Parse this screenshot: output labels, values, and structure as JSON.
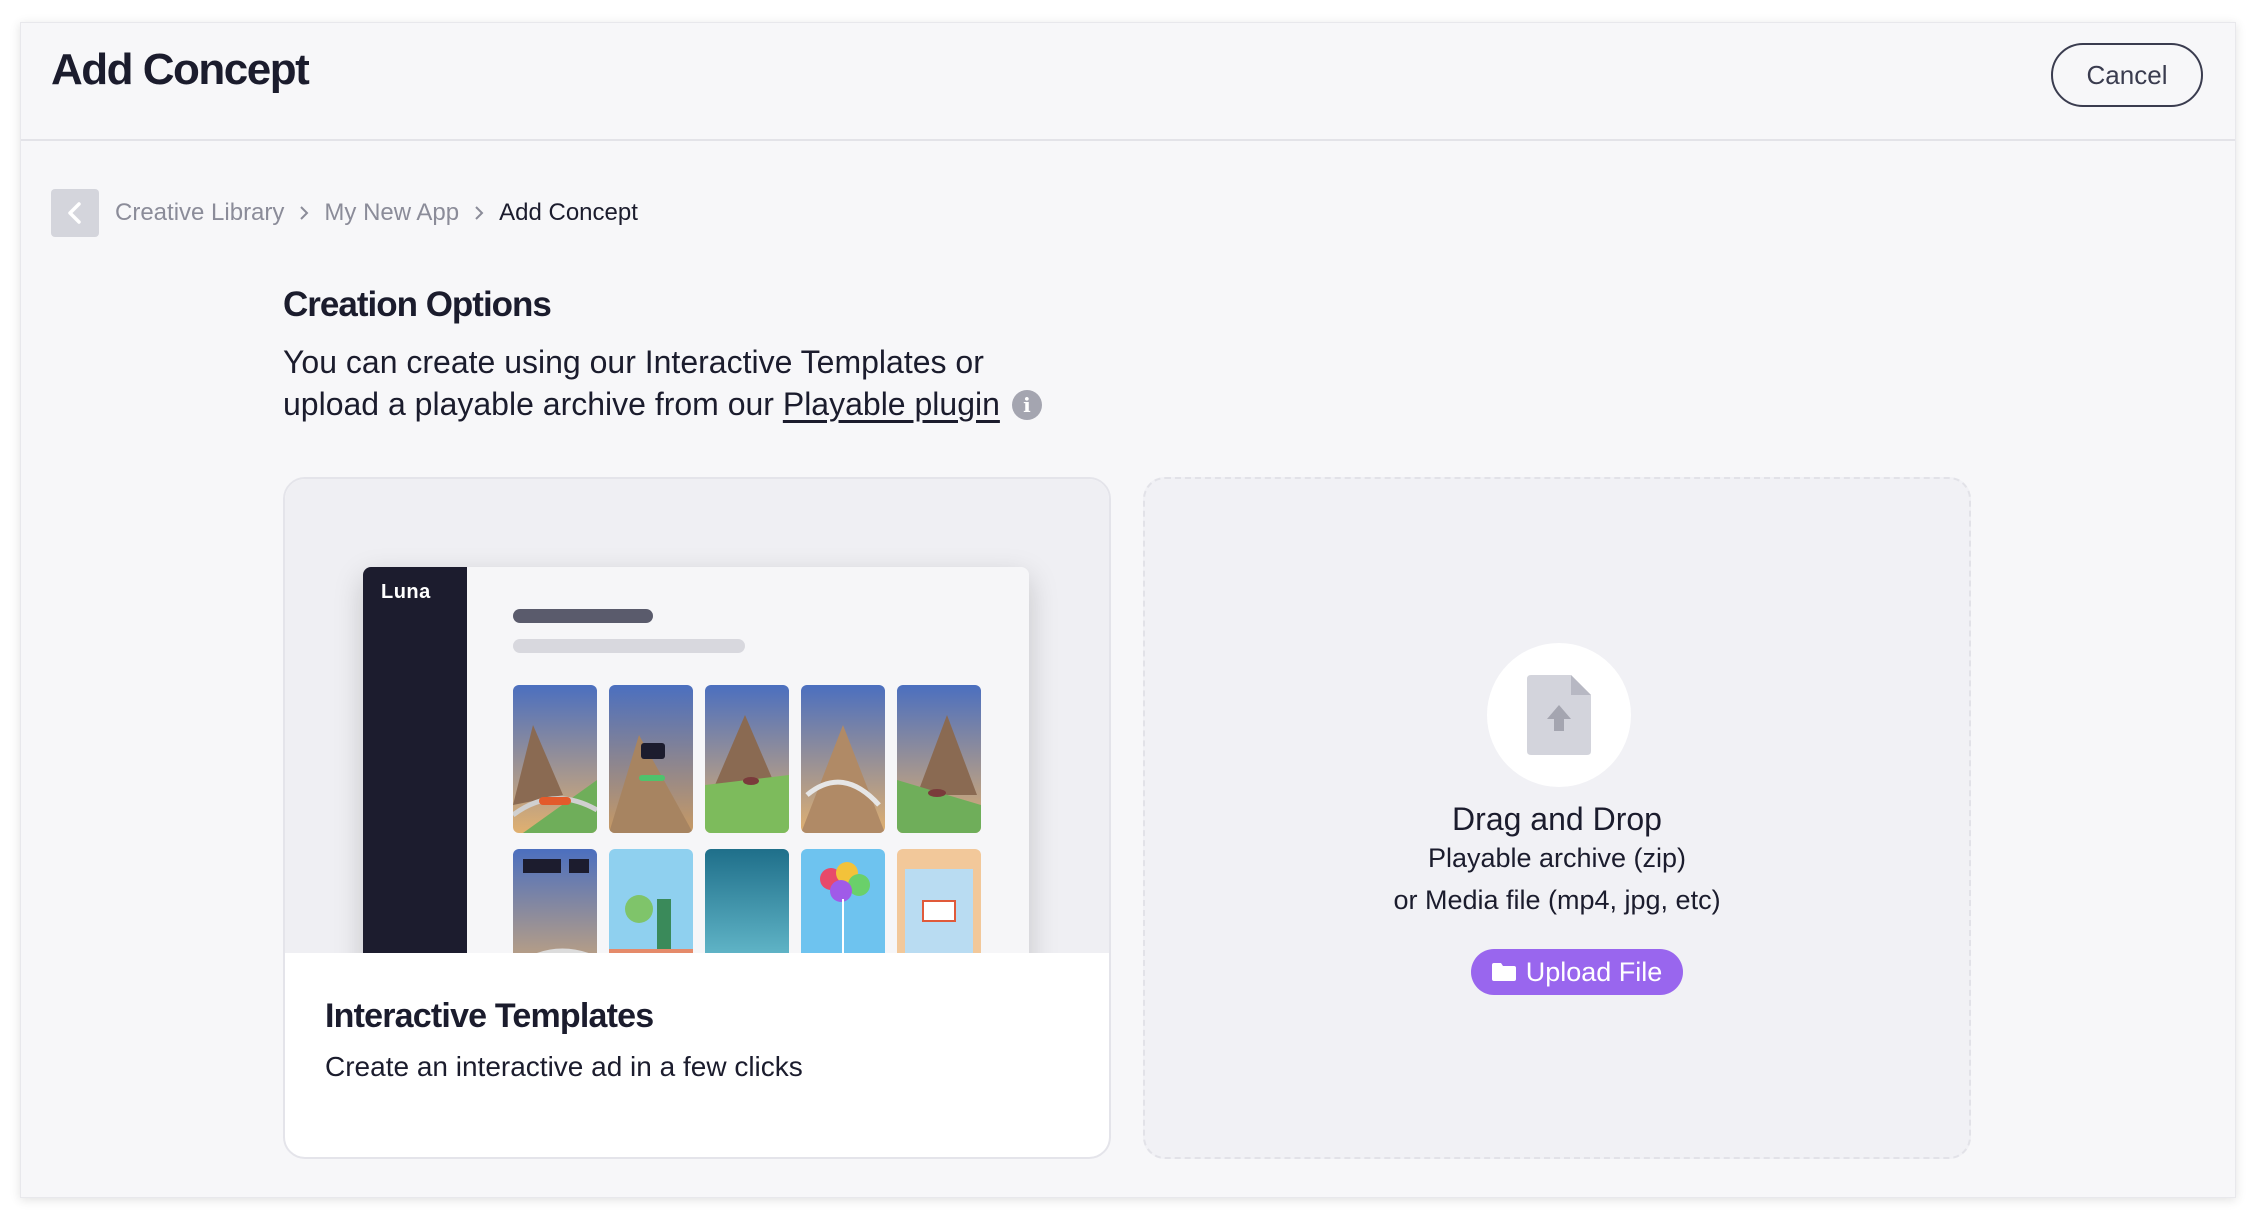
{
  "header": {
    "title": "Add Concept",
    "cancel_label": "Cancel"
  },
  "breadcrumb": {
    "items": [
      "Creative Library",
      "My New App",
      "Add Concept"
    ]
  },
  "creation": {
    "title": "Creation Options",
    "desc_line1": "You can create using our Interactive Templates or",
    "desc_line2_prefix": "upload a playable archive from our ",
    "plugin_link": "Playable plugin",
    "info_glyph": "i"
  },
  "templates_card": {
    "logo": "Luna",
    "title": "Interactive Templates",
    "subtitle": "Create an interactive ad in a few clicks"
  },
  "upload_card": {
    "title": "Drag and Drop",
    "line1": "Playable archive (zip)",
    "line2": "or Media file (mp4, jpg, etc)",
    "button_label": "Upload File"
  },
  "colors": {
    "accent": "#9966ee",
    "dark_sidebar": "#1c1c2e",
    "text": "#1b1c2d",
    "muted": "#8b8c99"
  },
  "icons": [
    "chevron-left-icon",
    "chevron-right-icon",
    "info-icon",
    "file-upload-icon",
    "folder-icon"
  ]
}
